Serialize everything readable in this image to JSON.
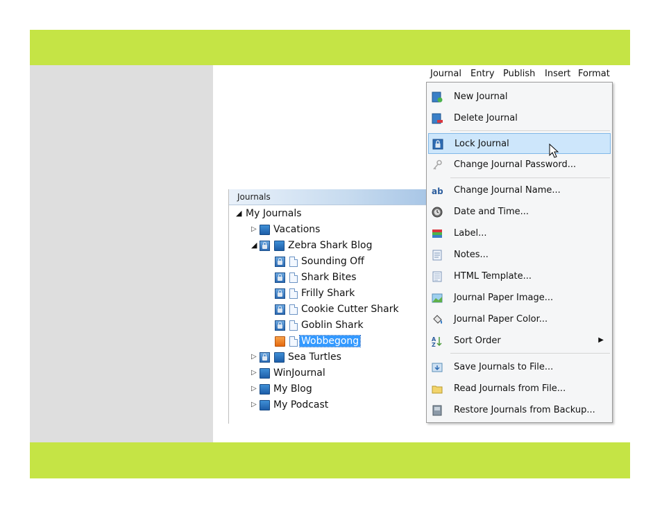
{
  "tree": {
    "header": "Journals",
    "nodes": [
      {
        "label": "My Journals",
        "tri": "open",
        "icons": []
      },
      {
        "label": "Vacations",
        "tri": "closed",
        "icons": [
          "book"
        ]
      },
      {
        "label": "Zebra Shark Blog",
        "tri": "open",
        "icons": [
          "lock",
          "book"
        ]
      },
      {
        "label": "Sounding Off",
        "tri": "",
        "icons": [
          "lock",
          "page"
        ]
      },
      {
        "label": "Shark Bites",
        "tri": "",
        "icons": [
          "lock",
          "page"
        ]
      },
      {
        "label": "Frilly Shark",
        "tri": "",
        "icons": [
          "lock",
          "page"
        ]
      },
      {
        "label": "Cookie Cutter Shark",
        "tri": "",
        "icons": [
          "lock",
          "page"
        ]
      },
      {
        "label": "Goblin Shark",
        "tri": "",
        "icons": [
          "lock",
          "page"
        ]
      },
      {
        "label": "Wobbegong",
        "tri": "",
        "icons": [
          "orange",
          "page"
        ],
        "selected": true
      },
      {
        "label": "Sea Turtles",
        "tri": "closed",
        "icons": [
          "lock",
          "book"
        ]
      },
      {
        "label": "WinJournal",
        "tri": "closed",
        "icons": [
          "book"
        ]
      },
      {
        "label": "My Blog",
        "tri": "closed",
        "icons": [
          "book"
        ]
      },
      {
        "label": "My Podcast",
        "tri": "closed",
        "icons": [
          "book"
        ]
      }
    ]
  },
  "menubar": {
    "journal": "Journal",
    "entry": "Entry",
    "publish": "Publish",
    "insert": "Insert",
    "format": "Format"
  },
  "menu": {
    "new_journal": "New Journal",
    "delete_journal": "Delete Journal",
    "lock_journal": "Lock Journal",
    "change_password": "Change Journal Password...",
    "change_name": "Change Journal Name...",
    "date_time": "Date and Time...",
    "label": "Label...",
    "notes": "Notes...",
    "html_template": "HTML Template...",
    "paper_image": "Journal Paper Image...",
    "paper_color": "Journal Paper Color...",
    "sort_order": "Sort Order",
    "save_to_file": "Save Journals to File...",
    "read_from_file": "Read Journals from File...",
    "restore_backup": "Restore Journals from Backup..."
  },
  "colors": {
    "band": "#c5e445",
    "sidebar_gray": "#dedede",
    "highlight": "#cde6fb",
    "selection": "#3399ff"
  }
}
